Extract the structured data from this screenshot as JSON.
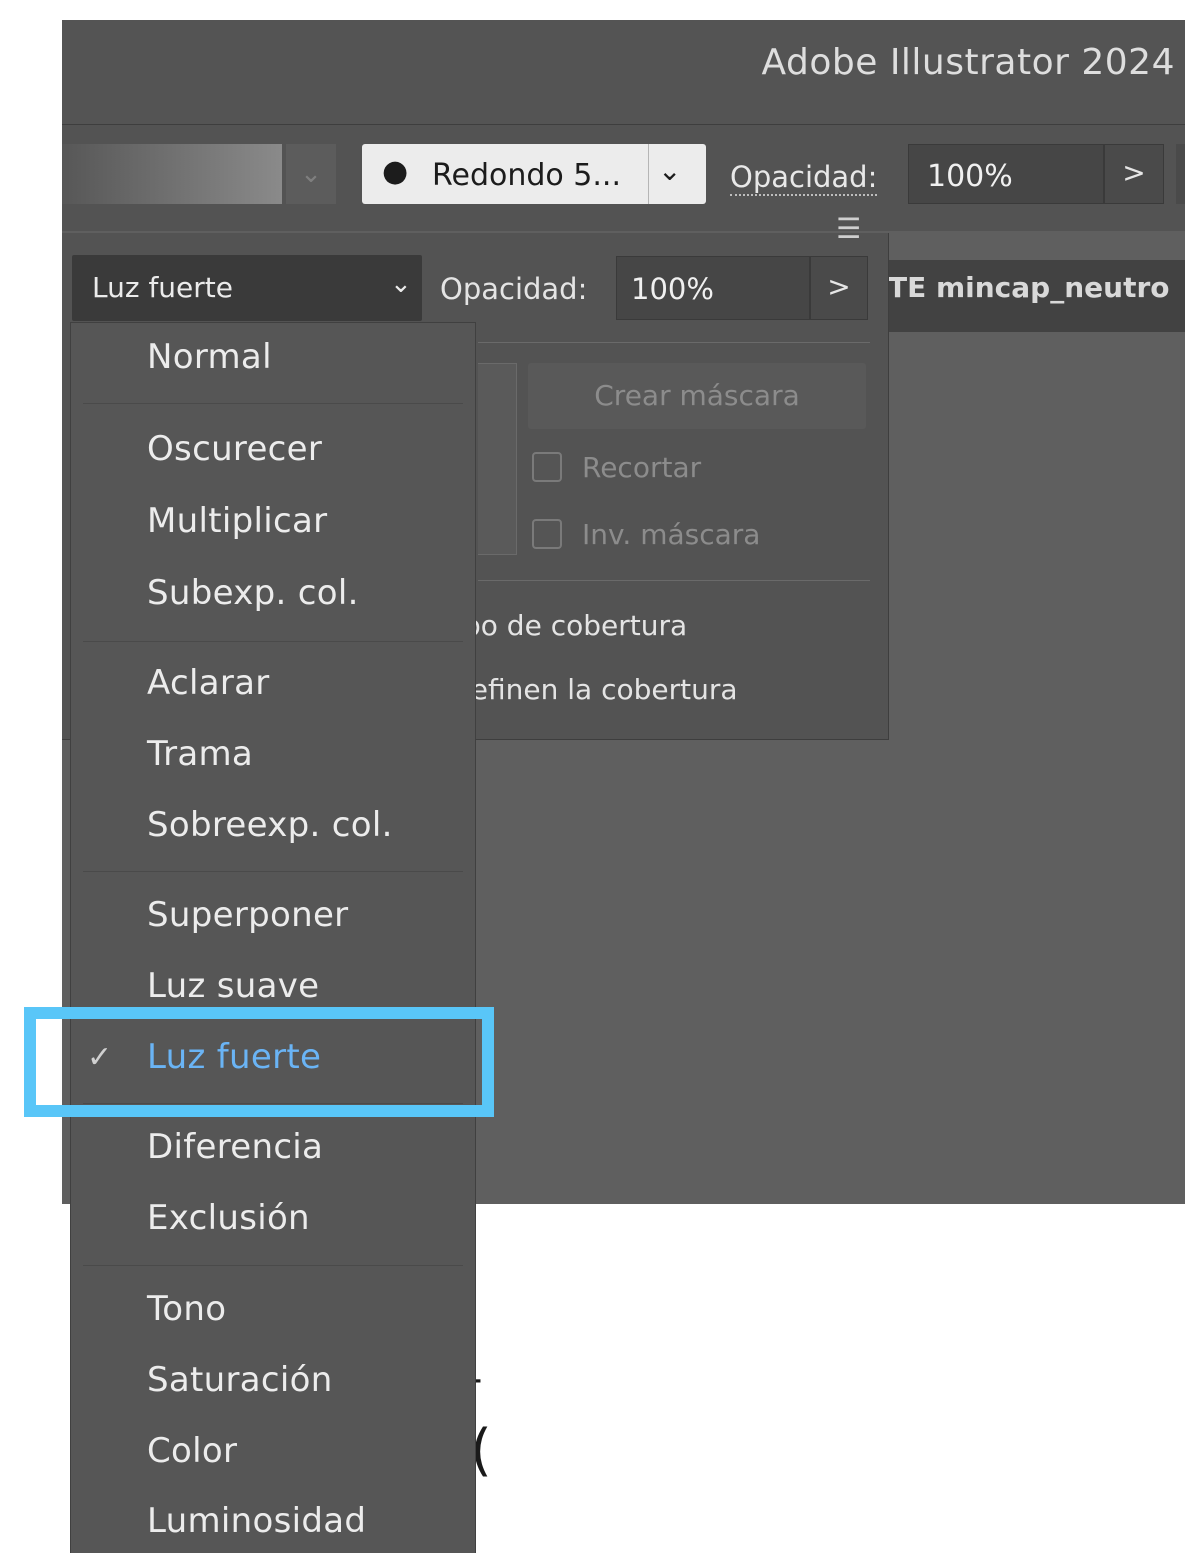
{
  "window": {
    "title": "Adobe Illustrator 2024"
  },
  "control_bar": {
    "brush_label": "Redondo 5...",
    "opacity_label": "Opacidad:",
    "opacity_value": "100%",
    "opacity_arrow": ">"
  },
  "document_tab": {
    "label": "TE mincap_neutro"
  },
  "transparency_panel": {
    "blend_mode": "Luz fuerte",
    "opacity_label": "Opacidad:",
    "opacity_value": "100%",
    "opacity_arrow": ">",
    "create_mask_label": "Crear máscara",
    "clip_label": "Recortar",
    "invert_mask_label": "Inv. máscara",
    "knockout_group_label": "po de cobertura",
    "define_knockout_label": "lefinen la cobertura"
  },
  "blend_dropdown": {
    "options": [
      "Normal",
      "Oscurecer",
      "Multiplicar",
      "Subexp. col.",
      "Aclarar",
      "Trama",
      "Sobreexp. col.",
      "Superponer",
      "Luz suave",
      "Luz fuerte",
      "Diferencia",
      "Exclusión",
      "Tono",
      "Saturación",
      "Color",
      "Luminosidad"
    ],
    "selected": "Luz fuerte",
    "check_mark": "✓"
  },
  "colors": {
    "highlight_frame": "#59c6f8",
    "selected_option": "#6ab4f5",
    "panel_background": "#535353"
  }
}
